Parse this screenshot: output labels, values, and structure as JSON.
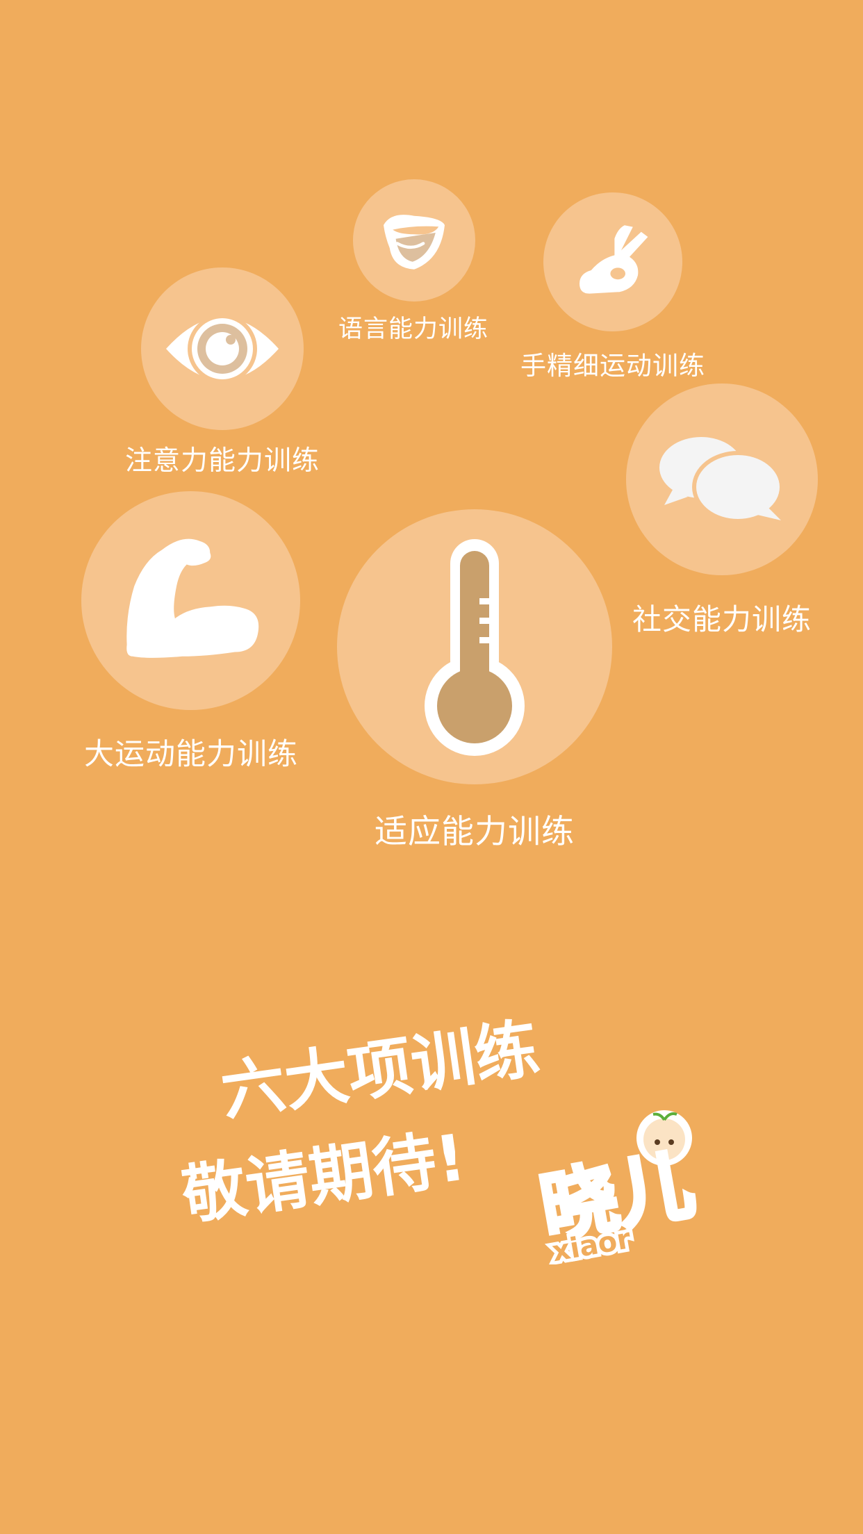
{
  "trainings": [
    {
      "label": "语言能力训练",
      "icon": "lips-icon"
    },
    {
      "label": "手精细运动训练",
      "icon": "ok-hand-icon"
    },
    {
      "label": "注意力能力训练",
      "icon": "eye-icon"
    },
    {
      "label": "社交能力训练",
      "icon": "chat-bubbles-icon"
    },
    {
      "label": "大运动能力训练",
      "icon": "flexed-arm-icon"
    },
    {
      "label": "适应能力训练",
      "icon": "thermometer-icon"
    }
  ],
  "slogan": {
    "line1": "六大项训练",
    "line2": "敬请期待!"
  },
  "brand": {
    "logo_char": "晓儿",
    "logo_latin": "xiaor"
  },
  "colors": {
    "background": "#f0ac5c",
    "bubble": "#f6c48e",
    "icon": "#ffffff",
    "accent": "#c9a06c"
  }
}
